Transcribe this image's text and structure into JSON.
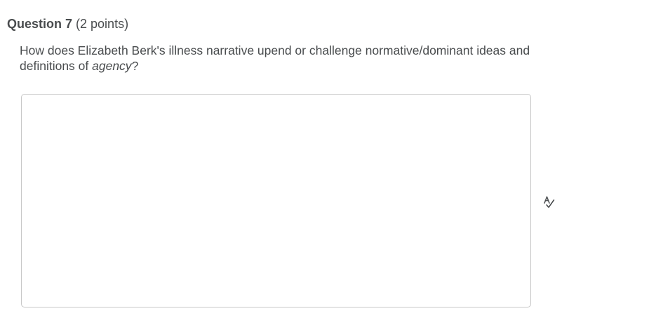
{
  "question": {
    "title": "Question 7",
    "points": "(2 points)",
    "prompt_main": "How does Elizabeth Berk's illness narrative upend or challenge normative/dominant ideas and definitions of ",
    "prompt_emphasis": "agency",
    "prompt_end": "?"
  },
  "answer": {
    "value": ""
  },
  "icons": {
    "spellcheck": "spellcheck-icon"
  }
}
